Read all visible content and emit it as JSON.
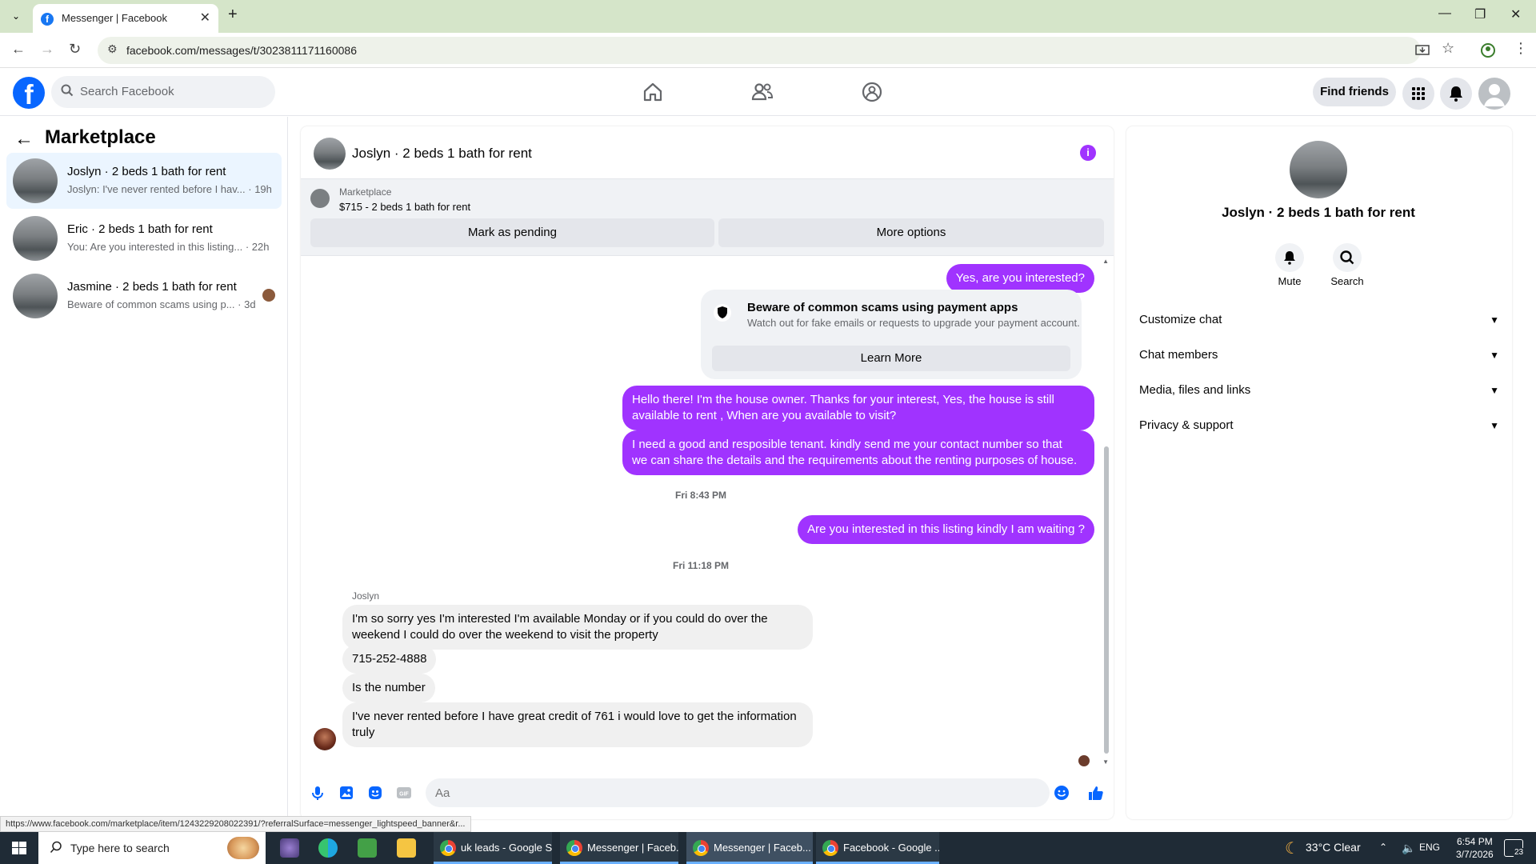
{
  "browser": {
    "tab_title": "Messenger | Facebook",
    "url": "facebook.com/messages/t/3023811171160086",
    "new_tab_symbol": "+",
    "close_symbol": "✕"
  },
  "fb_header": {
    "search_placeholder": "Search Facebook",
    "find_friends": "Find friends"
  },
  "sidebar": {
    "title": "Marketplace",
    "conversations": [
      {
        "name": "Joslyn · 2 beds 1 bath for rent",
        "snippet": "Joslyn: I've never rented before I hav...",
        "time": "· 19h"
      },
      {
        "name": "Eric · 2 beds 1 bath for rent",
        "snippet": "You: Are you interested in this listing...",
        "time": "· 22h"
      },
      {
        "name": "Jasmine · 2 beds 1 bath for rent",
        "snippet": "Beware of common scams using p...",
        "time": "· 3d"
      }
    ]
  },
  "chat": {
    "title": "Joslyn · 2 beds 1 bath for rent",
    "listing_source": "Marketplace",
    "listing_title": "$715 - 2 beds 1 bath for rent",
    "mark_pending": "Mark as pending",
    "more_options": "More options",
    "msg_interested": "Yes, are you interested?",
    "scam_title": "Beware of common scams using payment apps",
    "scam_text": "Watch out for fake emails or requests to upgrade your payment account.",
    "learn_more": "Learn More",
    "msg_hello_1": "Hello there! I'm the house owner. Thanks for your interest, Yes, the house is still",
    "msg_hello_2": "available to rent , When are you available to visit?",
    "msg_tenant_1": "I need a good and resposible tenant.  kindly send me your contact number so that",
    "msg_tenant_2": "we can share the details and the requirements about the renting purposes of house.",
    "ts1": "Fri 8:43 PM",
    "msg_waiting": "Are you interested in this listing kindly I am waiting ?",
    "ts2": "Fri 11:18 PM",
    "sender": "Joslyn",
    "in1_1": "I'm so sorry yes I'm interested I'm available Monday or if you could do over the",
    "in1_2": "weekend I could do over the weekend to visit the property",
    "in2": "715-252-4888",
    "in3": "Is the number",
    "in4_1": "I've never rented before I have great credit of 761 i would love to get the information",
    "in4_2": "truly",
    "input_placeholder": "Aa"
  },
  "right_panel": {
    "name": "Joslyn · 2 beds 1 bath for rent",
    "mute": "Mute",
    "search": "Search",
    "sections": [
      "Customize chat",
      "Chat members",
      "Media, files and links",
      "Privacy & support"
    ]
  },
  "status_url": "https://www.facebook.com/marketplace/item/1243229208022391/?referralSurface=messenger_lightspeed_banner&r...",
  "taskbar": {
    "search_placeholder": "Type here to search",
    "apps": [
      "uk leads - Google S...",
      "Messenger | Faceb...",
      "Messenger | Faceb...",
      "Facebook - Google ..."
    ],
    "weather": "33°C  Clear",
    "lang": "ENG",
    "time": "6:54 PM",
    "date": "3/7/2026",
    "notif_count": "23"
  },
  "colors": {
    "accent": "#a033ff",
    "fb_blue": "#0866ff",
    "chrome_green": "#d5e5c9"
  }
}
